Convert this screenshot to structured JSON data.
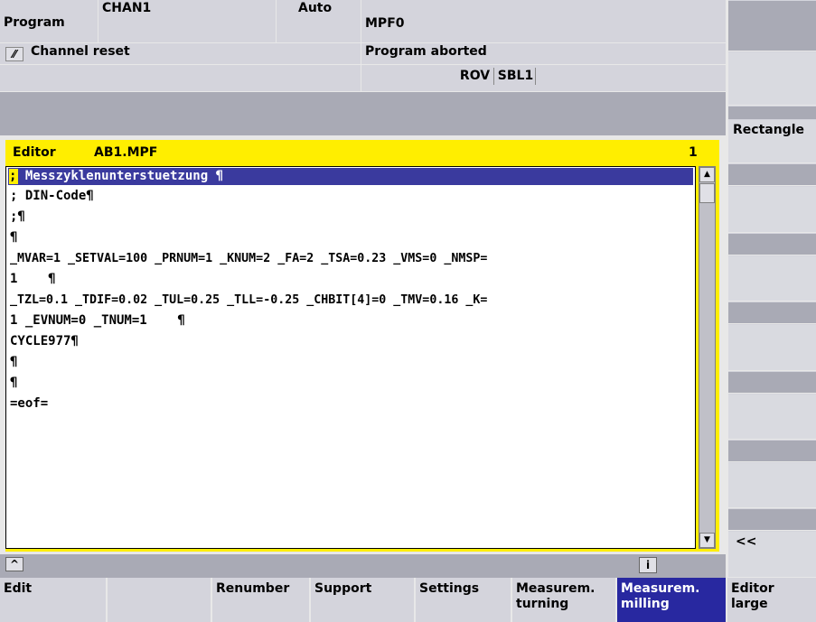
{
  "status": {
    "area_label": "Program",
    "channel": "CHAN1",
    "mode": "Auto",
    "program": "MPF0",
    "channel_state": "Channel reset",
    "program_state": "Program aborted",
    "flags": [
      "ROV",
      "SBL1"
    ]
  },
  "editor": {
    "label": "Editor",
    "file": "AB1.MPF",
    "line_no": "1",
    "lines": [
      "; Messzyklenunterstuetzung ¶",
      "; DIN-Code¶",
      ";¶",
      "¶",
      "_MVAR=1 _SETVAL=100 _PRNUM=1 _KNUM=2 _FA=2 _TSA=0.23 _VMS=0 _NMSP=",
      "1    ¶",
      "_TZL=0.1 _TDIF=0.02 _TUL=0.25 _TLL=-0.25 _CHBIT[4]=0 _TMV=0.16 _K=",
      "1 _EVNUM=0 _TNUM=1    ¶",
      "CYCLE977¶",
      "¶",
      "¶",
      "=eof="
    ],
    "cursor_char": ";"
  },
  "vertical_softkeys": [
    "",
    "",
    "Rectangle",
    "",
    "",
    "",
    "",
    "",
    "",
    "<<"
  ],
  "horizontal_softkeys": [
    "Edit",
    "",
    "Renumber",
    "Support",
    "Settings",
    "Measurem.\nturning",
    "Measurem.\nmilling",
    "Editor\nlarge"
  ],
  "bottom_bar": {
    "caret": "^",
    "info": "i"
  },
  "colors": {
    "highlight": "#3a3a9e",
    "editor_header": "#ffee00",
    "active_softkey": "#2828a0"
  }
}
